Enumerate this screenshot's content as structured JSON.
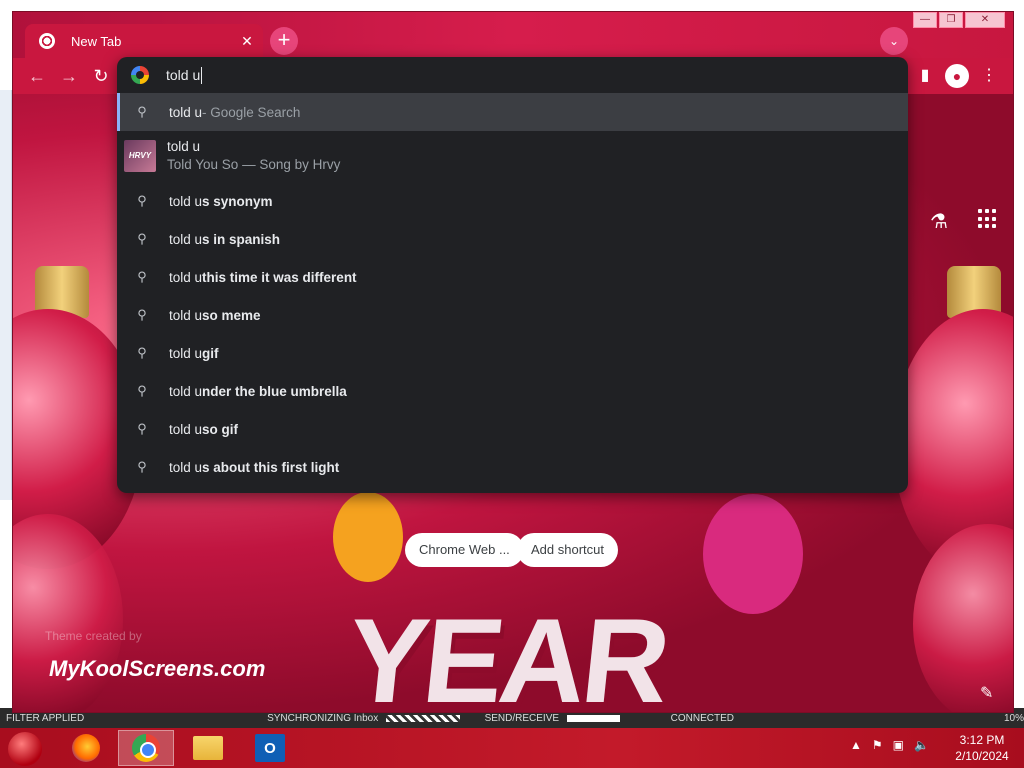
{
  "window": {
    "tab_title": "New Tab",
    "tab_close": "✕",
    "new_tab": "+",
    "tab_search": "⌄",
    "minimize": "—",
    "maximize": "❐",
    "close": "✕"
  },
  "toolbar": {
    "back": "←",
    "forward": "→",
    "reload": "↻",
    "sidebar_icon": "▮",
    "profile_icon": "●",
    "menu_icon": "⋮"
  },
  "omnibox": {
    "typed": "told u",
    "suggestions": [
      {
        "typed": "told u",
        "rest": "",
        "suffix": " - Google Search",
        "selected": true
      },
      {
        "typed": "told u",
        "rest": "",
        "subtitle": "Told You So — Song by Hrvy",
        "thumb": "HRVY"
      },
      {
        "typed": "told u",
        "rest": "s synonym"
      },
      {
        "typed": "told u",
        "rest": "s in spanish"
      },
      {
        "typed": "told u",
        "rest": " this time it was different"
      },
      {
        "typed": "told u",
        "rest": " so meme"
      },
      {
        "typed": "told u",
        "rest": " gif"
      },
      {
        "typed": "told u",
        "rest": "nder the blue umbrella"
      },
      {
        "typed": "told u",
        "rest": " so gif"
      },
      {
        "typed": "told u",
        "rest": "s about this first light"
      }
    ]
  },
  "ntp": {
    "shortcuts": [
      "Chrome Web ...",
      "Add shortcut"
    ],
    "theme_credit": "Theme created by",
    "watermark": "MyKoolScreens.com",
    "year_text": "YEAR"
  },
  "outlook_status": {
    "filter": "FILTER APPLIED",
    "sync": "SYNCHRONIZING   Inbox",
    "send_receive": "SEND/RECEIVE",
    "connected": "CONNECTED",
    "zoom": "10%"
  },
  "taskbar": {
    "time": "3:12 PM",
    "date": "2/10/2024"
  },
  "colors": {
    "theme": "#c9173f",
    "omnibox_bg": "#202124",
    "selected_row": "#3c3e43",
    "accent": "#8ab4f8"
  }
}
